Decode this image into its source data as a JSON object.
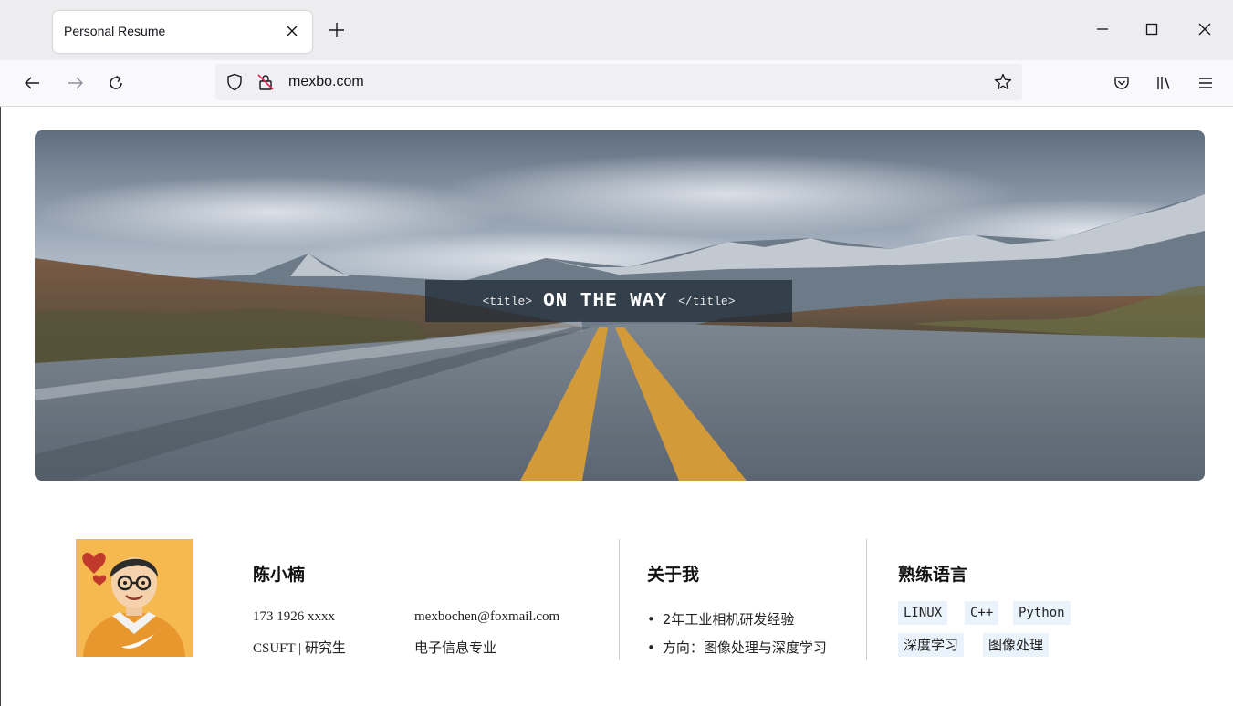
{
  "browser": {
    "tab_title": "Personal Resume",
    "url": "mexbo.com"
  },
  "hero": {
    "open_tag": "<title>",
    "title": "ON THE WAY",
    "close_tag": "</title>"
  },
  "profile": {
    "name": "陈小楠",
    "phone": "173 1926 xxxx",
    "email": "mexbochen@foxmail.com",
    "school": "CSUFT | 研究生",
    "major": "电子信息专业"
  },
  "about": {
    "title": "关于我",
    "items": [
      "2年工业相机研发经验",
      "方向：图像处理与深度学习"
    ]
  },
  "skills": {
    "title": "熟练语言",
    "tags": [
      "LINUX",
      "C++",
      "Python",
      "深度学习",
      "图像处理"
    ]
  },
  "colors": {
    "chrome_bg": "#ededf0",
    "urlbar_bg": "#f0f0f4",
    "skill_bg": "#eaf2fb",
    "hero_overlay": "#1e2834",
    "avatar_bg": "#f6b94f"
  }
}
